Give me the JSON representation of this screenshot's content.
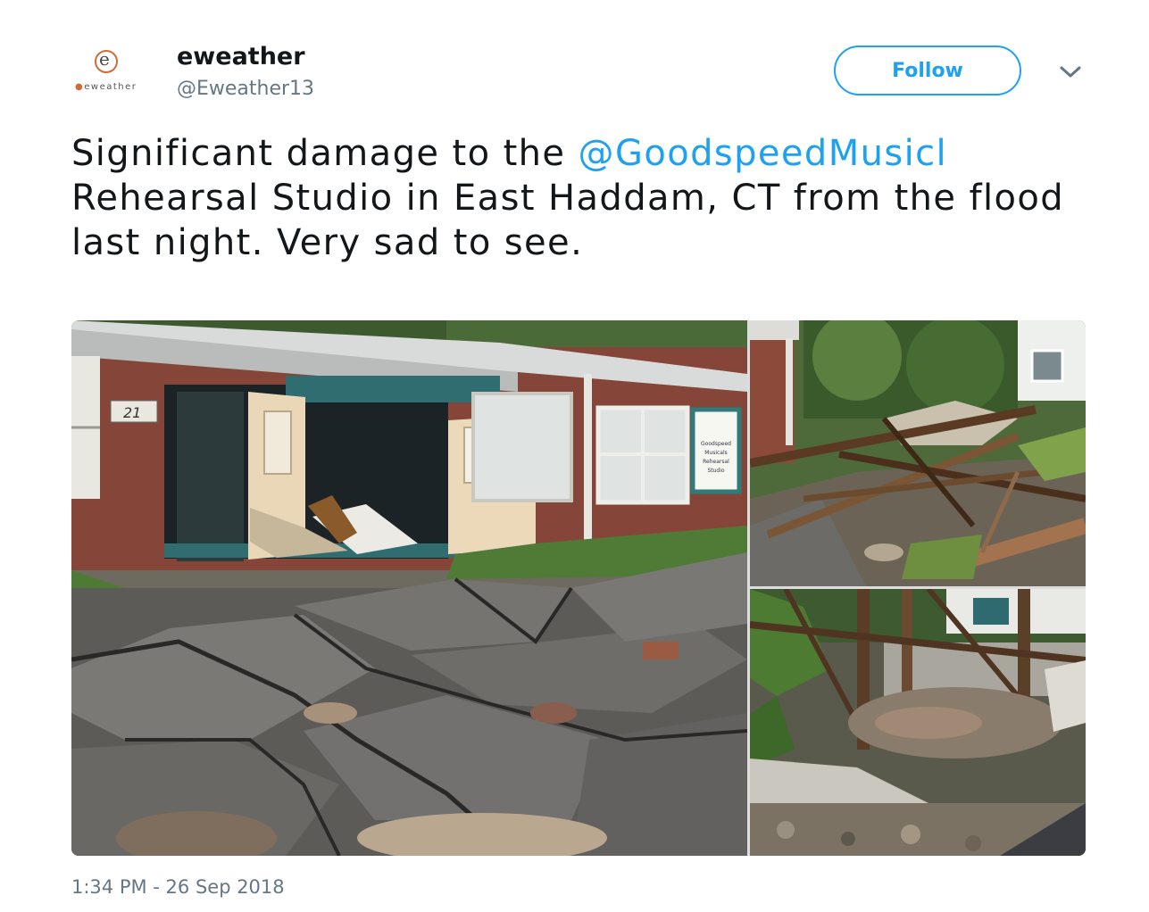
{
  "user": {
    "display_name": "eweather",
    "handle": "@Eweather13",
    "avatar_wordmark": "eweather",
    "avatar_icon": "eweather-logo"
  },
  "header": {
    "follow_label": "Follow",
    "menu_icon": "chevron-down-icon"
  },
  "tweet": {
    "text_before": "Significant damage to the ",
    "mention": "@GoodspeedMusicl",
    "text_after": " Rehearsal Studio in East Haddam, CT from the flood last night. Very sad to see.",
    "timestamp": "1:34 PM - 26 Sep 2018"
  },
  "media": {
    "photo1": {
      "door_number": "21",
      "sign_lines": [
        "Goodspeed",
        "Musicals",
        "Rehearsal",
        "Studio"
      ]
    }
  },
  "colors": {
    "link": "#1da1f2",
    "secondary": "#657786",
    "text": "#14171a"
  }
}
